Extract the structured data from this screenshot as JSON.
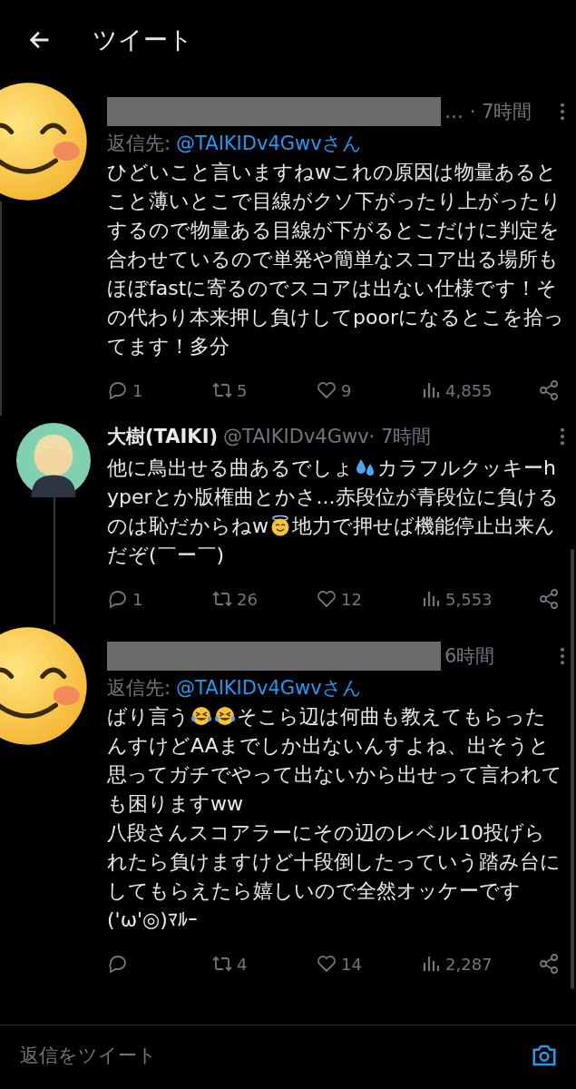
{
  "header": {
    "title": "ツイート"
  },
  "tweets": [
    {
      "avatar": {
        "kind": "smiley"
      },
      "redacted": true,
      "meta": "… · 7時間",
      "reply_to": {
        "label": "返信先:",
        "handle": "@TAIKIDv4Gwvさん"
      },
      "body": [
        {
          "kind": "text",
          "text": "ひどいこと言いますねwこれの原因は物量あるとこと薄いとこで目線がクソ下がったり上がったりするので物量ある目線が下がるとこだけに判定を合わせているので単発や簡単なスコア出る場所もほぼfastに寄るのでスコアは出ない仕様です！その代わり本来押し負けしてpoorになるとこを拾ってます！多分"
        }
      ],
      "thread_below": true,
      "actions": {
        "replies": "1",
        "retweets": "5",
        "likes": "9",
        "views": "4,855"
      }
    },
    {
      "avatar": {
        "kind": "character"
      },
      "redacted": false,
      "name": "大樹(TAIKI)",
      "handle": "@TAIKIDv4Gwv",
      "meta": " · 7時間",
      "body": [
        {
          "kind": "text",
          "text": "他に鳥出せる曲あるでしょ"
        },
        {
          "kind": "sweat-drops"
        },
        {
          "kind": "text",
          "text": "カラフルクッキーhyperとか版権曲とかさ...赤段位が青段位に負けるのは恥だからねw"
        },
        {
          "kind": "halo-face"
        },
        {
          "kind": "text",
          "text": "地力で押せば機能停止出来んだぞ(￣ー￣)"
        }
      ],
      "thread_below": true,
      "actions": {
        "replies": "1",
        "retweets": "26",
        "likes": "12",
        "views": "5,553"
      }
    },
    {
      "avatar": {
        "kind": "smiley"
      },
      "redacted": true,
      "meta": "6時間",
      "reply_to": {
        "label": "返信先:",
        "handle": "@TAIKIDv4Gwvさん"
      },
      "body": [
        {
          "kind": "text",
          "text": "ばり言う"
        },
        {
          "kind": "laughing-face"
        },
        {
          "kind": "laughing-face"
        },
        {
          "kind": "text",
          "text": "そこら辺は何曲も教えてもらったんすけどAAまでしか出ないんすよね、出そうと思ってガチでやって出ないから出せって言われても困りますww\n八段さんスコアラーにその辺のレベル10投げられたら負けますけど十段倒したっていう踏み台にしてもらえたら嬉しいので全然オッケーです('ω'◎)ﾏﾙｰ"
        }
      ],
      "thread_below": false,
      "actions": {
        "retweets": "4",
        "likes": "14",
        "views": "2,287"
      }
    }
  ],
  "composer": {
    "placeholder": "返信をツイート"
  }
}
